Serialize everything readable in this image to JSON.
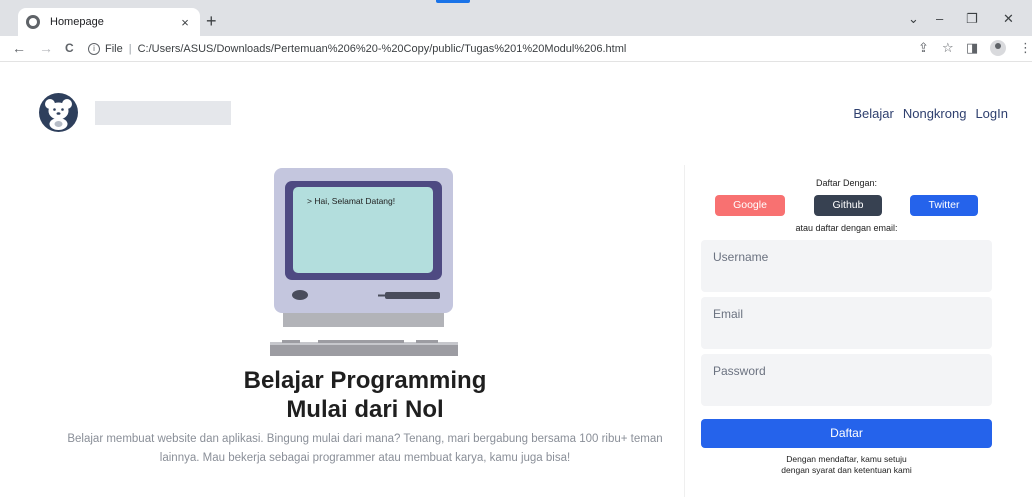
{
  "browser": {
    "tab_title": "Homepage",
    "tab_close": "×",
    "new_tab": "+",
    "url_scheme": "File",
    "url": "C:/Users/ASUS/Downloads/Pertemuan%206%20-%20Copy/public/Tugas%201%20Modul%206.html",
    "window_controls": [
      "⌄",
      "–",
      "❐",
      "✕"
    ],
    "nav_icons": [
      "←",
      "→",
      "C"
    ]
  },
  "header": {
    "nav_items": [
      "Belajar",
      "Nongkrong",
      "LogIn"
    ]
  },
  "hero": {
    "screen_text": "> Hai, Selamat Datang!",
    "title_line1": "Belajar Programming",
    "title_line2": "Mulai dari Nol",
    "description_line1": "Belajar membuat website dan aplikasi. Bingung mulai dari mana? Tenang, mari bergabung bersama 100 ribu+ teman",
    "description_line2": "lainnya. Mau bekerja sebagai programmer atau membuat karya, kamu juga bisa!"
  },
  "form": {
    "title": "Daftar Dengan:",
    "social": {
      "google": "Google",
      "github": "Github",
      "twitter": "Twitter"
    },
    "subtitle": "atau daftar dengan email:",
    "username_placeholder": "Username",
    "email_placeholder": "Email",
    "password_placeholder": "Password",
    "submit": "Daftar",
    "terms_line1": "Dengan mendaftar, kamu setuju",
    "terms_line2": "dengan syarat dan ketentuan kami"
  },
  "colors": {
    "google": "#f87171",
    "github": "#374151",
    "twitter": "#2563eb",
    "primary": "#2563eb",
    "nav_link": "#2e3f6e"
  }
}
